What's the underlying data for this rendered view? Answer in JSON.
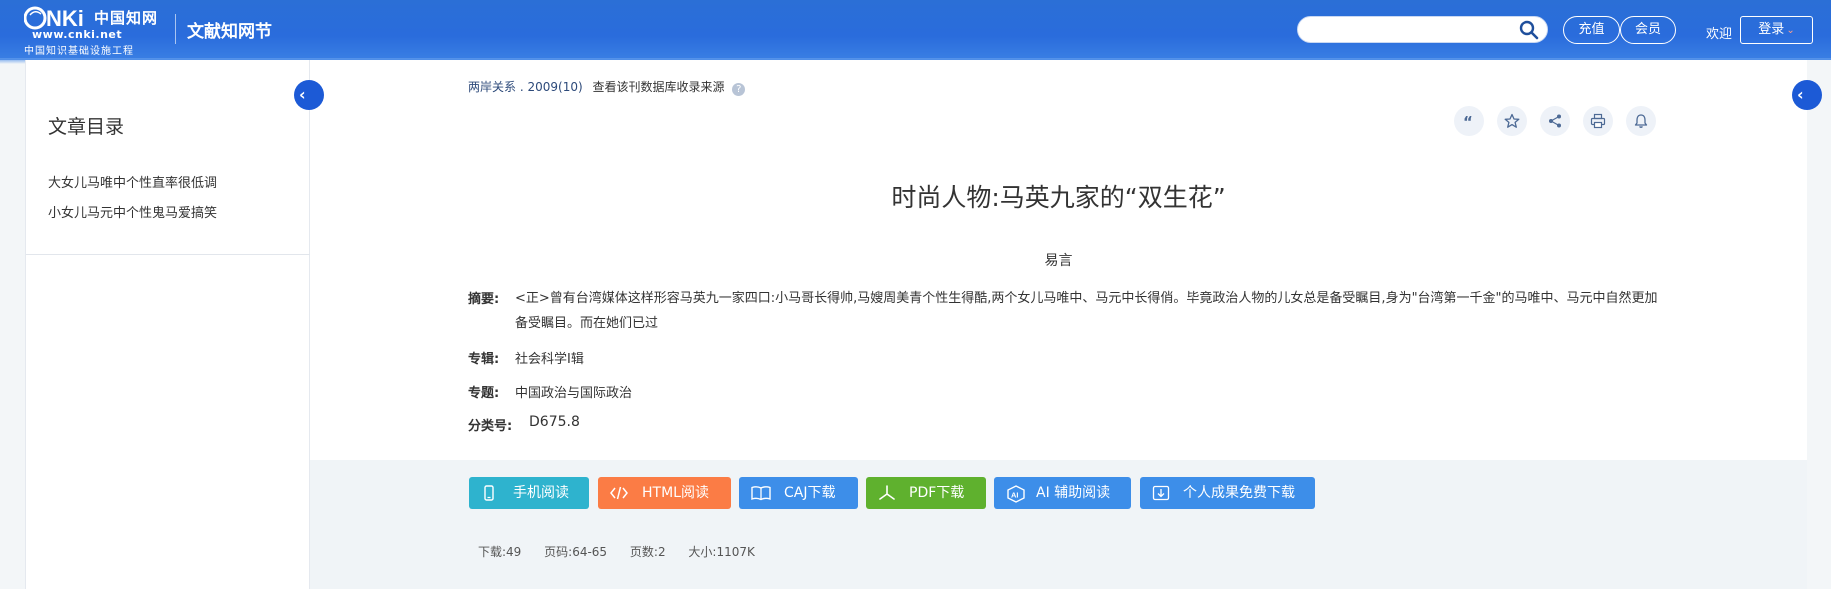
{
  "header": {
    "logo_main": "CNKi中国知网",
    "logo_url": "www.cnki.net",
    "logo_sub": "中国知识基础设施工程",
    "brand_sub": "文献知网节",
    "search": {
      "value": "",
      "placeholder": ""
    },
    "recharge_label": "充值",
    "member_label": "会员",
    "welcome_text": "欢迎",
    "login_label": "登录"
  },
  "sidebar": {
    "title": "文章目录",
    "items": [
      {
        "label": "大女儿马唯中个性直率很低调"
      },
      {
        "label": "小女儿马元中个性鬼马爱搞笑"
      }
    ]
  },
  "article": {
    "source_journal": "两岸关系",
    "source_issue": ". 2009(10)",
    "source_link": "查看该刊数据库收录来源",
    "title": "时尚人物:马英九家的“双生花”",
    "author": "易言",
    "abstract_label": "摘要:",
    "abstract": "<正>曾有台湾媒体这样形容马英九一家四口:小马哥长得帅,马嫂周美青个性生得酷,两个女儿马唯中、马元中长得俏。毕竟政治人物的儿女总是备受瞩目,身为\"台湾第一千金\"的马唯中、马元中自然更加备受瞩目。而在她们已过",
    "collection_label": "专辑:",
    "collection": "社会科学Ⅰ辑",
    "topic_label": "专题:",
    "topic": "中国政治与国际政治",
    "class_label": "分类号:",
    "class_no": "D675.8"
  },
  "tools": [
    "quote-icon",
    "star-icon",
    "share-icon",
    "print-icon",
    "bell-icon"
  ],
  "actions": {
    "mobile_read": "手机阅读",
    "html_read": "HTML阅读",
    "caj_download": "CAJ下载",
    "pdf_download": "PDF下载",
    "ai_read": "AI 辅助阅读",
    "free_download": "个人成果免费下载"
  },
  "stats": {
    "downloads": "下载:49",
    "pages": "页码:64-65",
    "page_count": "页数:2",
    "size": "大小:1107K"
  },
  "colors": {
    "header_blue": "#2b6fd6",
    "mobile": "#2eb3ce",
    "html": "#fb7c45",
    "blue_btn": "#3d8ee9",
    "pdf": "#5fb12e"
  }
}
